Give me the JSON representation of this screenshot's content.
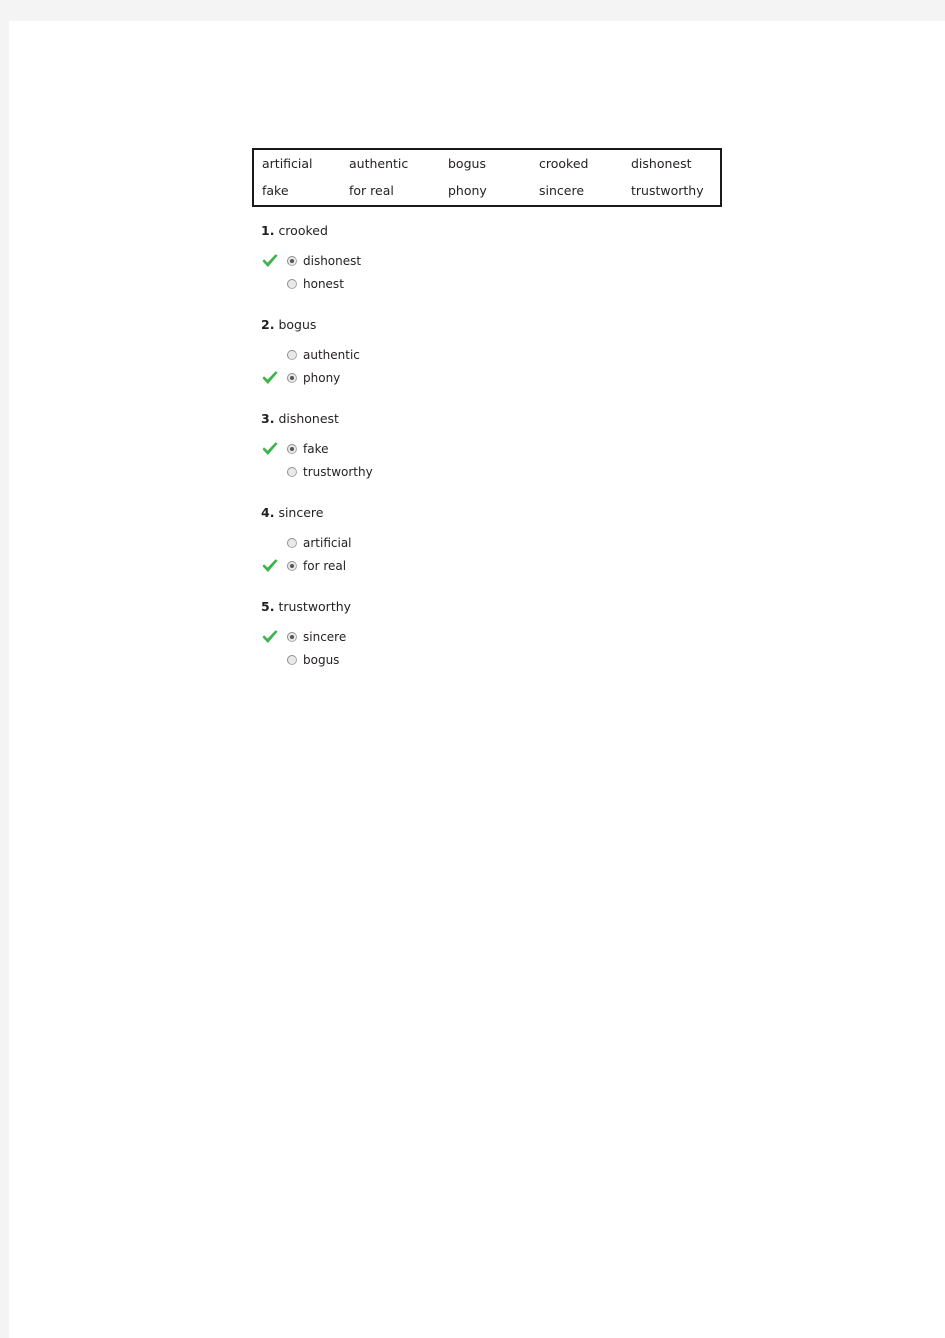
{
  "colors": {
    "page_background": "#f4f4f4",
    "sheet": "#ffffff",
    "text": "#231f20",
    "check_green": "#3cb44a",
    "table_border": "#1a1a1a"
  },
  "word_bank": {
    "rows": [
      [
        "artificial",
        "authentic",
        "bogus",
        "crooked",
        "dishonest"
      ],
      [
        "fake",
        "for real",
        "phony",
        "sincere",
        "trustworthy"
      ]
    ]
  },
  "questions": [
    {
      "number": "1.",
      "word": "crooked",
      "options": [
        {
          "label": "dishonest",
          "selected": true,
          "checked": true
        },
        {
          "label": "honest",
          "selected": false,
          "checked": false
        }
      ]
    },
    {
      "number": "2.",
      "word": "bogus",
      "options": [
        {
          "label": "authentic",
          "selected": false,
          "checked": false
        },
        {
          "label": "phony",
          "selected": true,
          "checked": true
        }
      ]
    },
    {
      "number": "3.",
      "word": "dishonest",
      "options": [
        {
          "label": "fake",
          "selected": true,
          "checked": true
        },
        {
          "label": "trustworthy",
          "selected": false,
          "checked": false
        }
      ]
    },
    {
      "number": "4.",
      "word": "sincere",
      "options": [
        {
          "label": "artificial",
          "selected": false,
          "checked": false
        },
        {
          "label": "for real",
          "selected": true,
          "checked": true
        }
      ]
    },
    {
      "number": "5.",
      "word": "trustworthy",
      "options": [
        {
          "label": "sincere",
          "selected": true,
          "checked": true
        },
        {
          "label": "bogus",
          "selected": false,
          "checked": false
        }
      ]
    }
  ]
}
